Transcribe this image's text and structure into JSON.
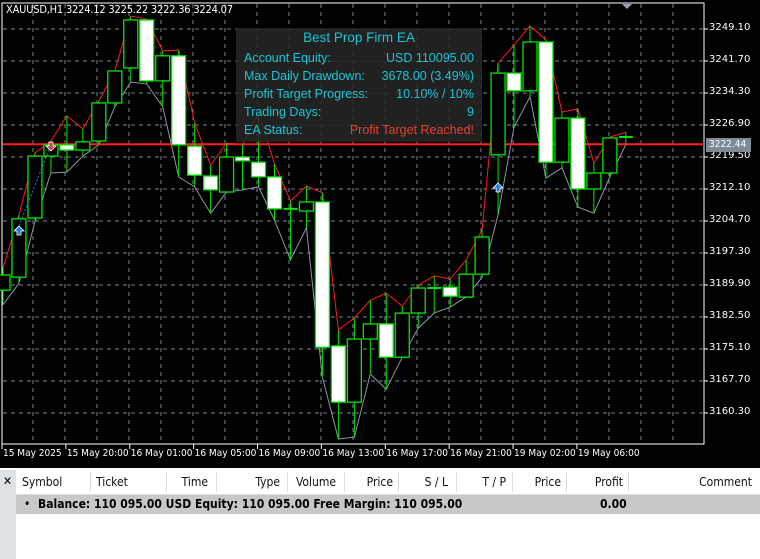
{
  "chart": {
    "symbol_header": "XAUUSD,H1  3224.12 3225.22 3222.36 3224.07",
    "current_price_tag": "3222.44",
    "colors": {
      "background": "#000000",
      "bull_outline": "#00e600",
      "bear_fill": "#ffffff",
      "grid": "#7a8590",
      "upper_line": "#ff1a1a",
      "lower_line": "#8a96a3",
      "price_line": "#ff2020",
      "buy_arrow": "#1e7fd8",
      "sell_arrow": "#e8402e"
    }
  },
  "dashboard": {
    "title": "Best Prop Firm EA",
    "rows": [
      {
        "label": "Account Equity:",
        "value": "USD 110095.00"
      },
      {
        "label": "Max Daily Drawdown:",
        "value": "3678.00 (3.49%)"
      },
      {
        "label": "Profit Target Progress:",
        "value": "10.10% / 10%"
      },
      {
        "label": "Trading Days:",
        "value": "9"
      },
      {
        "label": "EA Status:",
        "value": "Profit Target Reached!"
      }
    ],
    "colors": {
      "text": "#19c6d6",
      "status": "#e8402e"
    }
  },
  "chart_data": {
    "type": "candlestick",
    "ylim": [
      3155.0,
      3255.0
    ],
    "current_price": 3222.44,
    "y_tick_labels": [
      "3249.10",
      "3241.70",
      "3234.30",
      "3226.90",
      "3219.50",
      "3212.10",
      "3204.70",
      "3197.30",
      "3189.90",
      "3182.50",
      "3175.10",
      "3167.70",
      "3160.30"
    ],
    "x_tick_labels": [
      "15 May 2025",
      "15 May 20:00",
      "16 May 01:00",
      "16 May 05:00",
      "16 May 09:00",
      "16 May 13:00",
      "16 May 17:00",
      "16 May 21:00",
      "19 May 02:00",
      "19 May 06:00"
    ],
    "grid": true,
    "candles": [
      [
        3188.7,
        3193.8,
        3185.3,
        3192.2
      ],
      [
        3191.7,
        3206.1,
        3190.3,
        3205.2
      ],
      [
        3205.4,
        3220.4,
        3204.5,
        3219.7
      ],
      [
        3219.7,
        3223.2,
        3215.8,
        3222.3
      ],
      [
        3222.3,
        3229.0,
        3216.0,
        3221.1
      ],
      [
        3221.1,
        3226.0,
        3219.7,
        3223.0
      ],
      [
        3223.2,
        3232.4,
        3222.3,
        3232.0
      ],
      [
        3232.0,
        3239.4,
        3231.1,
        3239.4
      ],
      [
        3240.1,
        3252.1,
        3236.8,
        3251.2
      ],
      [
        3251.2,
        3251.4,
        3236.4,
        3237.1
      ],
      [
        3237.1,
        3244.0,
        3231.1,
        3242.9
      ],
      [
        3242.9,
        3244.2,
        3214.9,
        3222.3
      ],
      [
        3222.0,
        3227.4,
        3212.6,
        3215.3
      ],
      [
        3215.1,
        3217.6,
        3206.5,
        3211.9
      ],
      [
        3211.4,
        3222.7,
        3211.4,
        3219.5
      ],
      [
        3219.5,
        3222.3,
        3211.9,
        3218.6
      ],
      [
        3218.3,
        3229.9,
        3212.6,
        3214.9
      ],
      [
        3214.9,
        3217.9,
        3204.9,
        3207.5
      ],
      [
        3207.5,
        3209.3,
        3195.7,
        3207.5
      ],
      [
        3207.0,
        3212.8,
        3203.1,
        3209.1
      ],
      [
        3209.1,
        3211.2,
        3168.6,
        3175.5
      ],
      [
        3175.8,
        3179.5,
        3154.3,
        3162.8
      ],
      [
        3162.8,
        3182.3,
        3154.7,
        3177.4
      ],
      [
        3177.4,
        3186.4,
        3169.3,
        3180.9
      ],
      [
        3180.9,
        3188.0,
        3165.8,
        3173.2
      ],
      [
        3173.2,
        3185.0,
        3173.2,
        3183.4
      ],
      [
        3183.4,
        3189.9,
        3179.9,
        3189.2
      ],
      [
        3189.2,
        3192.0,
        3183.4,
        3189.2
      ],
      [
        3189.4,
        3191.3,
        3184.8,
        3187.3
      ],
      [
        3187.1,
        3195.7,
        3187.1,
        3192.4
      ],
      [
        3192.4,
        3202.6,
        3191.7,
        3201.0
      ],
      [
        3220.0,
        3241.2,
        3206.1,
        3238.9
      ],
      [
        3238.9,
        3245.4,
        3226.4,
        3234.8
      ],
      [
        3234.8,
        3249.8,
        3233.4,
        3246.1
      ],
      [
        3246.1,
        3246.6,
        3214.6,
        3218.3
      ],
      [
        3218.3,
        3229.9,
        3217.0,
        3228.5
      ],
      [
        3228.5,
        3230.6,
        3207.9,
        3212.1
      ],
      [
        3212.1,
        3218.1,
        3206.5,
        3215.8
      ],
      [
        3215.8,
        3224.1,
        3214.9,
        3223.9
      ],
      [
        3224.12,
        3225.22,
        3222.36,
        3224.07
      ]
    ],
    "candle_fields": [
      "open",
      "high",
      "low",
      "close"
    ],
    "buy_signals": [
      1,
      31
    ],
    "sell_signals": [
      3
    ]
  },
  "terminal": {
    "close_label": "✕",
    "columns": [
      "Symbol",
      "Ticket",
      "Time",
      "Type",
      "Volume",
      "Price",
      "S / L",
      "T / P",
      "Price",
      "Profit",
      "Comment"
    ],
    "balance_row": {
      "bullet": "•",
      "text": "Balance: 110 095.00 USD  Equity: 110 095.00  Free Margin: 110 095.00",
      "profit": "0.00"
    }
  }
}
